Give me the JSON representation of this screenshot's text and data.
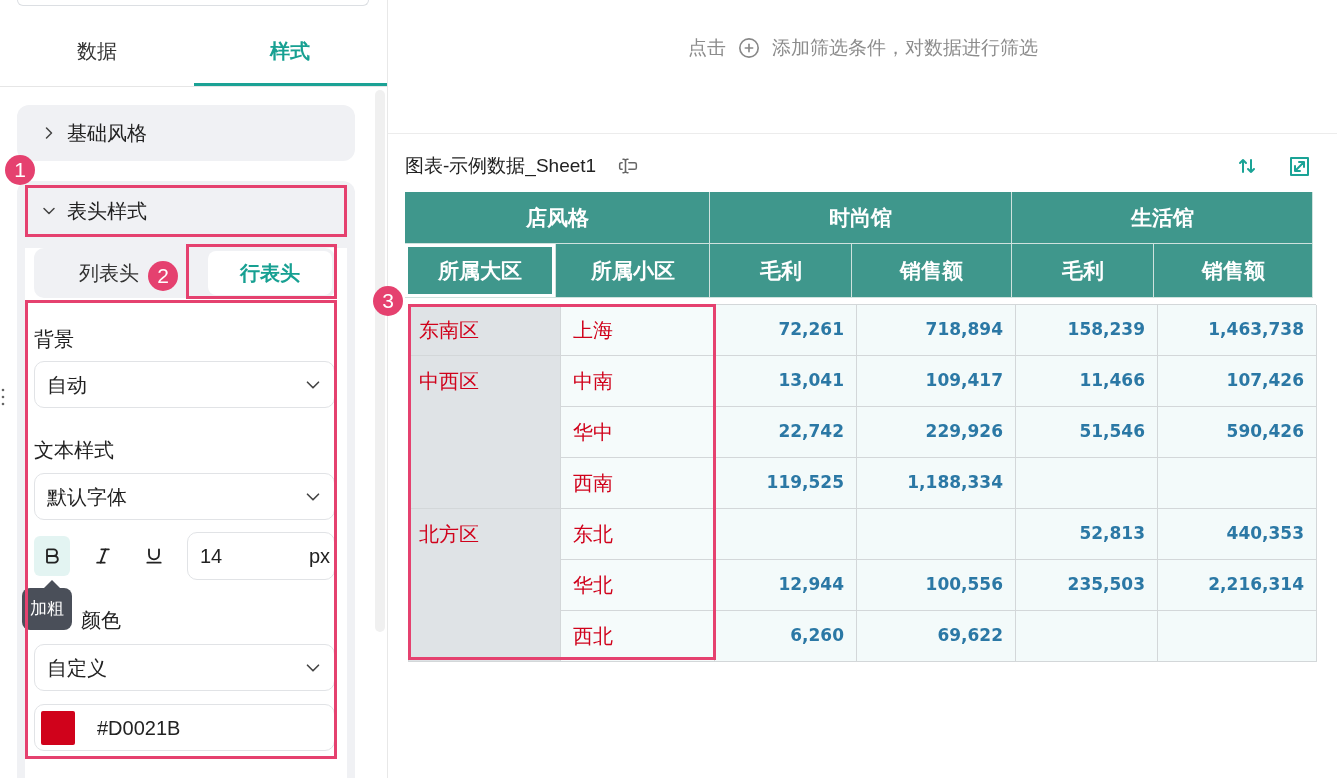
{
  "top_tabs": [
    {
      "label": "数据",
      "selected": false
    },
    {
      "label": "样式",
      "selected": true
    }
  ],
  "sections": [
    {
      "title": "基础风格",
      "expanded": false,
      "highlighted": false
    },
    {
      "title": "表头样式",
      "expanded": true,
      "highlighted": true,
      "header_tabs": [
        {
          "label": "列表头",
          "selected": false
        },
        {
          "label": "行表头",
          "selected": true
        }
      ],
      "form": {
        "background": {
          "label": "背景",
          "value": "自动"
        },
        "text_style": {
          "label": "文本样式",
          "value": "默认字体"
        },
        "format_buttons": [
          {
            "kind": "bold",
            "selected": true
          },
          {
            "kind": "italic",
            "selected": false
          },
          {
            "kind": "underline",
            "selected": false
          }
        ],
        "font_size": {
          "value": "14",
          "unit": "px"
        },
        "tooltip": "加粗",
        "font_color": {
          "label": "颜色",
          "mode": "自定义",
          "value": "#D0021B"
        }
      }
    }
  ],
  "filter_hint": {
    "before": "点击",
    "after": "添加筛选条件，对数据进行筛选"
  },
  "chart": {
    "title": "图表-示例数据_Sheet1",
    "table": {
      "corner": "店风格",
      "row_header_columns": [
        {
          "label": "所属大区",
          "selected": true
        },
        {
          "label": "所属小区",
          "selected": false
        }
      ],
      "column_groups": [
        {
          "label": "时尚馆",
          "columns": [
            {
              "label": "毛利",
              "selected": false
            },
            {
              "label": "销售额",
              "selected": false
            }
          ]
        },
        {
          "label": "生活馆",
          "columns": [
            {
              "label": "毛利",
              "selected": false
            },
            {
              "label": "销售额",
              "selected": false
            }
          ]
        }
      ],
      "regions": [
        {
          "name": "东南区",
          "rows": [
            {
              "name": "上海",
              "fashion_profit": "72,261",
              "fashion_sales": "718,894",
              "life_profit": "158,239",
              "life_sales": "1,463,738"
            }
          ]
        },
        {
          "name": "中西区",
          "rows": [
            {
              "name": "中南",
              "fashion_profit": "13,041",
              "fashion_sales": "109,417",
              "life_profit": "11,466",
              "life_sales": "107,426"
            },
            {
              "name": "华中",
              "fashion_profit": "22,742",
              "fashion_sales": "229,926",
              "life_profit": "51,546",
              "life_sales": "590,426"
            },
            {
              "name": "西南",
              "fashion_profit": "119,525",
              "fashion_sales": "1,188,334"
            }
          ]
        },
        {
          "name": "北方区",
          "rows": [
            {
              "name": "东北",
              "life_profit": "52,813",
              "life_sales": "440,353"
            },
            {
              "name": "华北",
              "fashion_profit": "12,944",
              "fashion_sales": "100,556",
              "life_profit": "235,503",
              "life_sales": "2,216,314"
            },
            {
              "name": "西北",
              "fashion_profit": "6,260",
              "fashion_sales": "69,622"
            }
          ]
        }
      ]
    }
  },
  "annotations": [
    {
      "number": "1"
    },
    {
      "number": "2"
    },
    {
      "number": "3"
    }
  ]
}
